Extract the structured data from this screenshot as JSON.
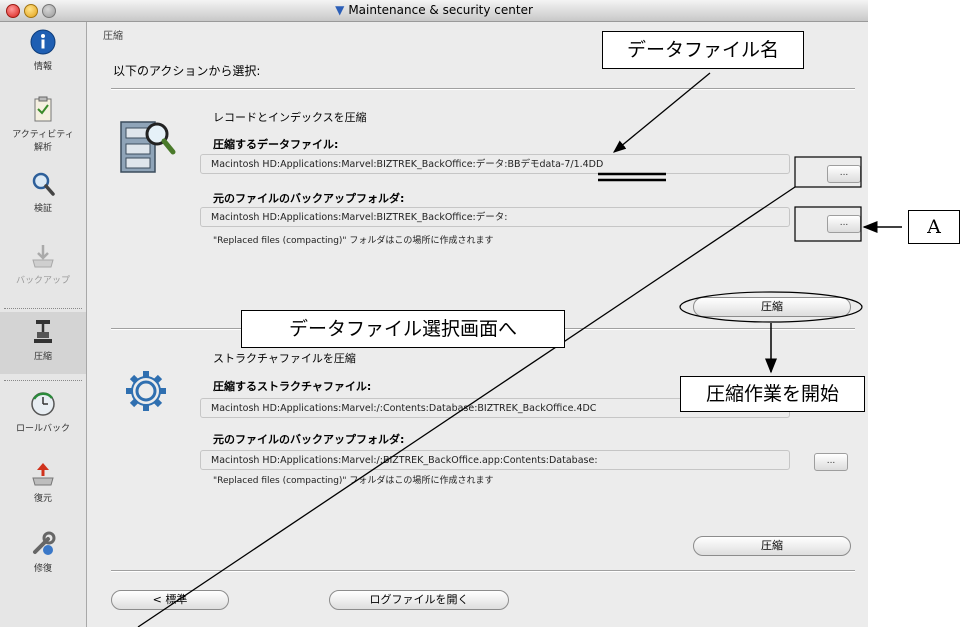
{
  "window": {
    "title": "Maintenance & security center"
  },
  "sidebar": {
    "items": [
      {
        "label": "情報",
        "icon": "info-icon"
      },
      {
        "label_line1": "アクティビティ",
        "label_line2": "解析",
        "icon": "clipboard-icon"
      },
      {
        "label": "検証",
        "icon": "magnifier-icon"
      },
      {
        "label": "バックアップ",
        "icon": "backup-tray-icon",
        "disabled": true
      },
      {
        "label": "圧縮",
        "icon": "compact-press-icon",
        "active": true
      },
      {
        "label": "ロールバック",
        "icon": "rollback-clock-icon"
      },
      {
        "label": "復元",
        "icon": "restore-up-arrow-icon"
      },
      {
        "label": "修復",
        "icon": "repair-wrench-icon"
      }
    ]
  },
  "main": {
    "section_label": "圧縮",
    "choose_heading": "以下のアクションから選択:",
    "records": {
      "title": "レコードとインデックスを圧縮",
      "data_file_label": "圧縮するデータファイル:",
      "data_file_path": "Macintosh HD:Applications:Marvel:BIZTREK_BackOffice:データ:BBデモdata-7/1.4DD",
      "backup_label": "元のファイルのバックアップフォルダ:",
      "backup_path": "Macintosh HD:Applications:Marvel:BIZTREK_BackOffice:データ:",
      "note": "\"Replaced files (compacting)\" フォルダはこの場所に作成されます",
      "browse_label": "...",
      "compact_button": "圧縮"
    },
    "structure": {
      "title": "ストラクチャファイルを圧縮",
      "structure_file_label": "圧縮するストラクチャファイル:",
      "structure_file_path": "Macintosh HD:Applications:Marvel:/:Contents:Database:BIZTREK_BackOffice.4DC",
      "backup_label": "元のファイルのバックアップフォルダ:",
      "backup_path": "Macintosh HD:Applications:Marvel:/:BIZTREK_BackOffice.app:Contents:Database:",
      "note": "\"Replaced files (compacting)\" フォルダはこの場所に作成されます",
      "browse_label": "...",
      "compact_button": "圧縮"
    },
    "footer": {
      "standard_button": "< 標準",
      "open_log_button": "ログファイルを開く"
    }
  },
  "annotations": {
    "data_file_name": "データファイル名",
    "to_data_file_selection": "データファイル選択画面へ",
    "start_compaction": "圧縮作業を開始",
    "marker_a": "A"
  }
}
